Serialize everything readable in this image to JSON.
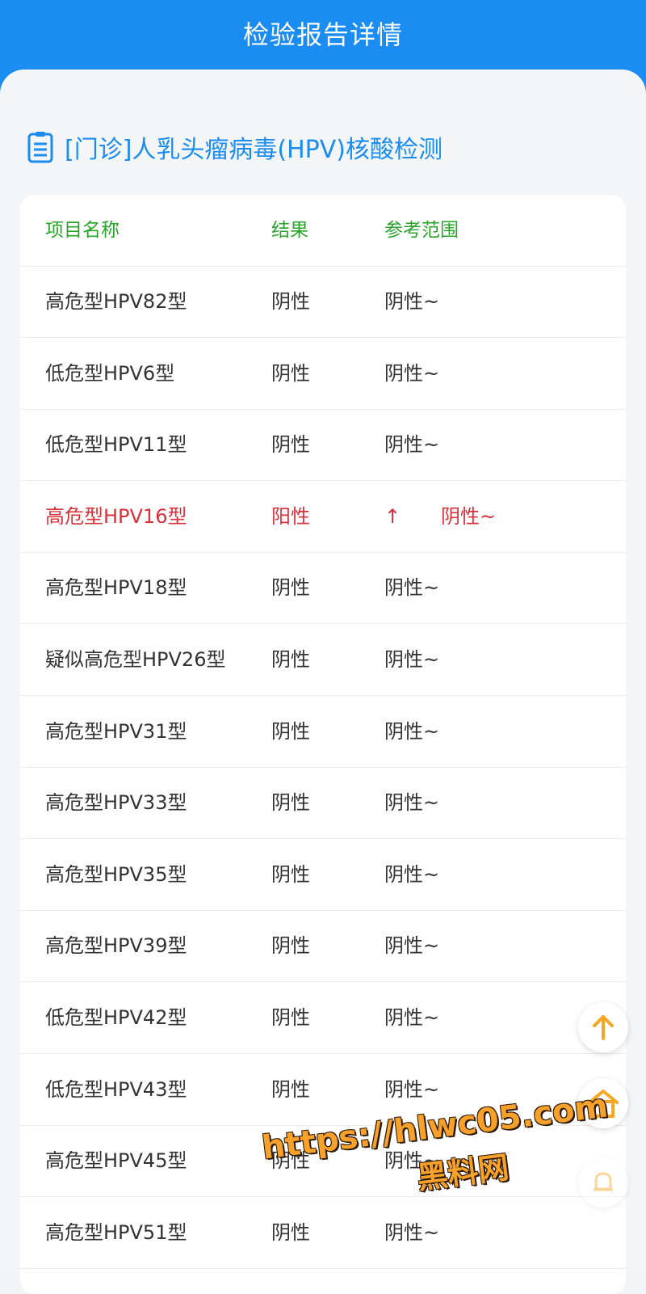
{
  "header": {
    "title": "检验报告详情"
  },
  "report": {
    "title": "[门诊]人乳头瘤病毒(HPV)核酸检测"
  },
  "table": {
    "columns": [
      "项目名称",
      "结果",
      "参考范围"
    ],
    "rows": [
      {
        "name": "高危型HPV82型",
        "result": "阴性",
        "flag": "",
        "range": "阴性~"
      },
      {
        "name": "低危型HPV6型",
        "result": "阴性",
        "flag": "",
        "range": "阴性~"
      },
      {
        "name": "低危型HPV11型",
        "result": "阴性",
        "flag": "",
        "range": "阴性~"
      },
      {
        "name": "高危型HPV16型",
        "result": "阳性",
        "flag": "↑",
        "range": "阴性~"
      },
      {
        "name": "高危型HPV18型",
        "result": "阴性",
        "flag": "",
        "range": "阴性~"
      },
      {
        "name": "疑似高危型HPV26型",
        "result": "阴性",
        "flag": "",
        "range": "阴性~"
      },
      {
        "name": "高危型HPV31型",
        "result": "阴性",
        "flag": "",
        "range": "阴性~"
      },
      {
        "name": "高危型HPV33型",
        "result": "阴性",
        "flag": "",
        "range": "阴性~"
      },
      {
        "name": "高危型HPV35型",
        "result": "阴性",
        "flag": "",
        "range": "阴性~"
      },
      {
        "name": "高危型HPV39型",
        "result": "阴性",
        "flag": "",
        "range": "阴性~"
      },
      {
        "name": "低危型HPV42型",
        "result": "阴性",
        "flag": "",
        "range": "阴性~"
      },
      {
        "name": "低危型HPV43型",
        "result": "阴性",
        "flag": "",
        "range": "阴性~"
      },
      {
        "name": "高危型HPV45型",
        "result": "阴性",
        "flag": "",
        "range": "阴性~"
      },
      {
        "name": "高危型HPV51型",
        "result": "阴性",
        "flag": "",
        "range": "阴性~"
      }
    ]
  },
  "floating_buttons": [
    {
      "icon": "arrow-up-icon"
    },
    {
      "icon": "home-icon"
    },
    {
      "icon": "bell-icon"
    }
  ],
  "watermark": {
    "url": "https://hlwc05.com",
    "text": "黑料网"
  },
  "colors": {
    "primary": "#1a8cf2",
    "header_text": "#2aa32a",
    "abnormal": "#d9303a",
    "fab_accent": "#f5a623"
  }
}
